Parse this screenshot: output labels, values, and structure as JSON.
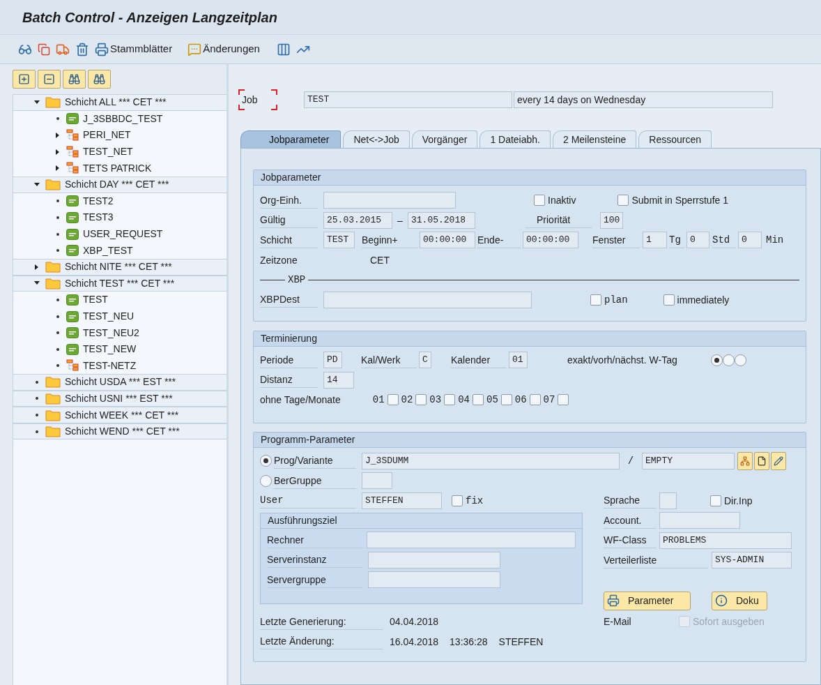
{
  "window": {
    "title": "Batch Control - Anzeigen Langzeitplan"
  },
  "toolbar": {
    "buttons": [
      {
        "label": "Stammblätter"
      },
      {
        "label": "Änderungen"
      }
    ]
  },
  "tree": [
    {
      "kind": "folder",
      "label": "Schicht ALL *** CET ***",
      "expanded": true,
      "children": [
        {
          "kind": "job",
          "label": "J_3SBBDC_TEST"
        },
        {
          "kind": "net",
          "label": "PERI_NET",
          "expanded": false
        },
        {
          "kind": "net",
          "label": "TEST_NET",
          "expanded": false
        },
        {
          "kind": "net",
          "label": "TETS PATRICK",
          "expanded": false
        }
      ]
    },
    {
      "kind": "folder",
      "label": "Schicht DAY *** CET ***",
      "expanded": true,
      "children": [
        {
          "kind": "job",
          "label": "TEST2"
        },
        {
          "kind": "job",
          "label": "TEST3"
        },
        {
          "kind": "job",
          "label": "USER_REQUEST"
        },
        {
          "kind": "job",
          "label": "XBP_TEST"
        }
      ]
    },
    {
      "kind": "folder",
      "label": "Schicht NITE *** CET ***",
      "expanded": false
    },
    {
      "kind": "folder",
      "label": "Schicht TEST *** CET ***",
      "expanded": true,
      "children": [
        {
          "kind": "job",
          "label": "TEST"
        },
        {
          "kind": "job",
          "label": "TEST_NEU"
        },
        {
          "kind": "job",
          "label": "TEST_NEU2"
        },
        {
          "kind": "job",
          "label": "TEST_NEW"
        },
        {
          "kind": "net",
          "label": "TEST-NETZ"
        }
      ]
    },
    {
      "kind": "folder",
      "label": "Schicht USDA *** EST ***"
    },
    {
      "kind": "folder",
      "label": "Schicht USNI *** EST ***"
    },
    {
      "kind": "folder",
      "label": "Schicht WEEK *** CET ***"
    },
    {
      "kind": "folder",
      "label": "Schicht WEND *** CET ***"
    }
  ],
  "job": {
    "label": "Job",
    "value": "TEST",
    "description": "every 14 days on Wednesday"
  },
  "tabs": [
    {
      "label": "Jobparameter",
      "selected": true
    },
    {
      "label": "Net<->Job",
      "selected": false
    },
    {
      "label": "Vorgänger",
      "selected": false
    },
    {
      "label": "1 Dateiabh.",
      "selected": false
    },
    {
      "label": "2 Meilensteine",
      "selected": false
    },
    {
      "label": "Ressourcen",
      "selected": false
    }
  ],
  "jobparameter": {
    "title": "Jobparameter",
    "org": {
      "label": "Org-Einh."
    },
    "inaktiv": {
      "label": "Inaktiv",
      "checked": false
    },
    "submit": {
      "label": "Submit in Sperrstufe 1",
      "checked": false
    },
    "gueltig": {
      "label": "Gültig",
      "from": "25.03.2015",
      "separator": "–",
      "to": "31.05.2018"
    },
    "prioritaet": {
      "label": "Priorität",
      "value": "100"
    },
    "schicht": {
      "label": "Schicht",
      "value": "TEST"
    },
    "beginn": {
      "label": "Beginn+",
      "value": "00:00:00"
    },
    "ende": {
      "label": "Ende-",
      "value": "00:00:00"
    },
    "fenster": {
      "label": "Fenster",
      "value": "1"
    },
    "tg": {
      "label": "Tg",
      "value": "0"
    },
    "std": {
      "label": "Std",
      "value": "0"
    },
    "min_label": "Min",
    "zeitzone": {
      "label": "Zeitzone",
      "value": "CET"
    },
    "xbp_title": "XBP",
    "xbpdest": {
      "label": "XBPDest"
    },
    "plan": {
      "label": "plan",
      "checked": false
    },
    "immediately": {
      "label": "immediately",
      "checked": false
    }
  },
  "terminierung": {
    "title": "Terminierung",
    "periode": {
      "label": "Periode",
      "value": "PD"
    },
    "kalwerk": {
      "label": "Kal/Werk",
      "value": "C"
    },
    "kalender": {
      "label": "Kalender",
      "value": "01"
    },
    "wtag": {
      "label": "exakt/vorh/nächst. W-Tag",
      "options": [
        {
          "selected": true
        },
        {
          "selected": false
        },
        {
          "selected": false
        }
      ]
    },
    "distanz": {
      "label": "Distanz",
      "value": "14"
    },
    "ohne": {
      "label": "ohne Tage/Monate",
      "days": [
        {
          "label": "01",
          "checked": false
        },
        {
          "label": "02",
          "checked": false
        },
        {
          "label": "03",
          "checked": false
        },
        {
          "label": "04",
          "checked": false
        },
        {
          "label": "05",
          "checked": false
        },
        {
          "label": "06",
          "checked": false
        },
        {
          "label": "07",
          "checked": false
        }
      ]
    }
  },
  "programm": {
    "title": "Programm-Parameter",
    "prog": {
      "label": "Prog/Variante",
      "selected": true,
      "value": "J_3SDUMM",
      "separator": "/",
      "variant": "EMPTY"
    },
    "bergruppe": {
      "label": "BerGruppe",
      "selected": false
    },
    "user": {
      "label": "User",
      "value": "STEFFEN"
    },
    "fix": {
      "label": "fix",
      "checked": false
    },
    "sprache": {
      "label": "Sprache"
    },
    "dirinp": {
      "label": "Dir.Inp",
      "checked": false
    },
    "ziel": {
      "title": "Ausführungsziel",
      "fields": [
        {
          "label": "Rechner"
        },
        {
          "label": "Serverinstanz"
        },
        {
          "label": "Servergruppe"
        }
      ]
    },
    "account": {
      "label": "Account."
    },
    "wfclass": {
      "label": "WF-Class",
      "value": "PROBLEMS"
    },
    "verteiler": {
      "label": "Verteilerliste",
      "value": "SYS-ADMIN"
    },
    "buttons": [
      {
        "label": "Parameter"
      },
      {
        "label": "Doku"
      }
    ],
    "email": {
      "label": "E-Mail"
    },
    "sofort": {
      "label": "Sofort ausgeben",
      "checked": false,
      "disabled": true
    },
    "generierung": {
      "label": "Letzte Generierung:",
      "date": "04.04.2018"
    },
    "aenderung": {
      "label": "Letzte Änderung:",
      "date": "16.04.2018",
      "time": "13:36:28",
      "user": "STEFFEN"
    }
  }
}
